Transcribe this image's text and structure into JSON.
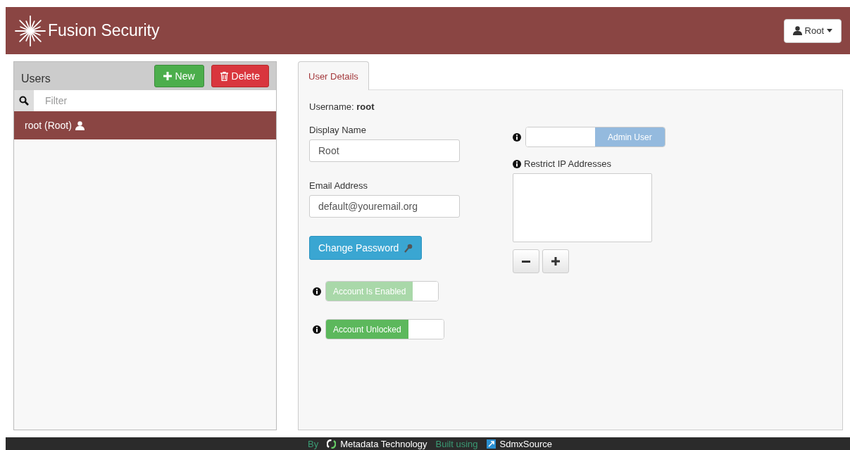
{
  "header": {
    "title": "Fusion Security",
    "user_menu": "Root"
  },
  "users_panel": {
    "title": "Users",
    "buttons": [
      {
        "kind": "new",
        "label": "New"
      },
      {
        "kind": "delete",
        "label": "Delete"
      }
    ],
    "filter": {
      "placeholder": "Filter"
    },
    "users": [
      {
        "label": "root (Root)",
        "selected": true
      }
    ]
  },
  "tabs": [
    {
      "label": "User Details",
      "selected": true
    }
  ],
  "details": {
    "username_label": "Username:",
    "username": "root",
    "display_name": {
      "label": "Display Name",
      "value": "Root"
    },
    "email": {
      "label": "Email Address",
      "value": "default@youremail.org"
    },
    "change_password": "Change Password",
    "switches": [
      {
        "label": "Account Is Enabled",
        "on": true,
        "disabled": true
      },
      {
        "label": "Account Unlocked",
        "on": true,
        "disabled": false
      }
    ],
    "admin_switch": {
      "label": "Admin User",
      "on": false,
      "disabled": true
    },
    "restrict_ip": {
      "label": "Restrict IP Addresses"
    }
  },
  "footer": {
    "by": "By",
    "company": "Metadata Technology",
    "built_using": "Built using",
    "product": "SdmxSource"
  }
}
